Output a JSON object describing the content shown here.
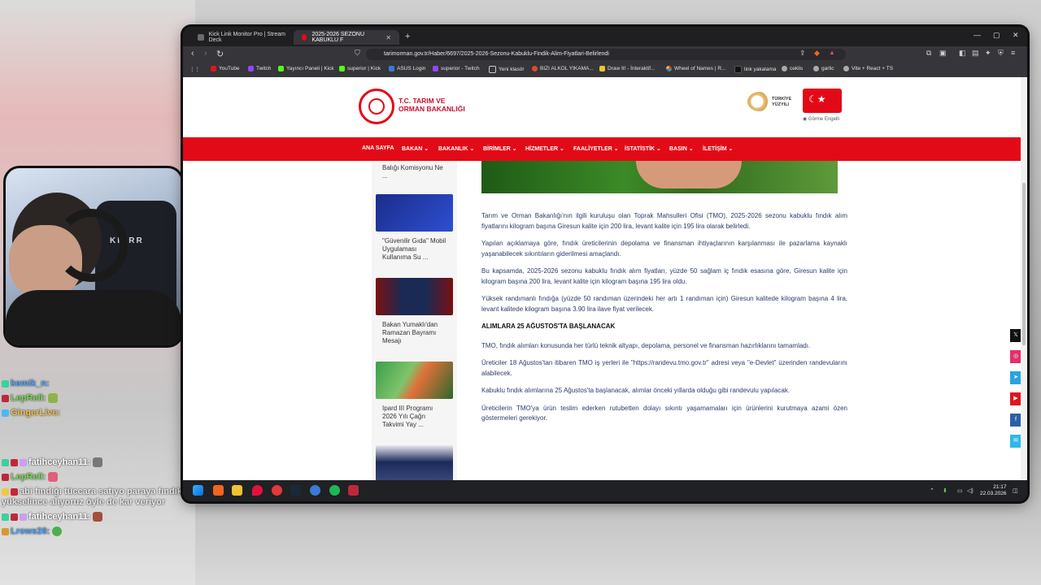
{
  "chat": [
    {
      "user": "kemik_n:",
      "message": "",
      "user_color": "#4fa3f7",
      "badge_color": "#3ad19a"
    },
    {
      "user": "LepRell:",
      "message": "",
      "user_color": "#7bd65a",
      "badge_color": "#c0283a"
    },
    {
      "user": "GingerLive:",
      "message": "",
      "user_color": "#f2c04a",
      "badge_color": "#4cb7ff"
    },
    {
      "user": "fatihceyhan11:",
      "message": "",
      "user_color": "#ffffff",
      "badge_color": "#3ad19a"
    },
    {
      "user": "LepRell:",
      "message": "",
      "user_color": "#7bd65a",
      "badge_color": "#c0283a"
    },
    {
      "user": "",
      "message": "abi fındığı tüccara satıyo paraya fındık yükselince alıyoruz öyle de kar veriyor",
      "user_color": "#9be36a",
      "badge_color": "#f4c542"
    },
    {
      "user": "fatihceyhan11:",
      "message": "",
      "user_color": "#ffffff",
      "badge_color": "#3ad19a"
    },
    {
      "user": "Lrows28:",
      "message": "",
      "user_color": "#4fa3f7",
      "badge_color": "#d79a2a"
    }
  ],
  "webcam": {
    "chair_label": "KIARR"
  },
  "browser": {
    "tabs": [
      {
        "label": "Kick Link Monitor Pro | Stream Deck",
        "active": false
      },
      {
        "label": "2025-2026 SEZONU KABUKLU F",
        "active": true
      }
    ],
    "url": "tarimorman.gov.tr/Haber/6697/2025-2026-Sezonu-Kabuklu-Findik-Alim-Fiyatlari-Belirlendi",
    "bookmarks": [
      "YouTube",
      "Twitch",
      "Yayıncı Paneli | Kick",
      "superior | Kick",
      "ASUS Login",
      "superior - Twitch",
      "Yeni klasör",
      "BIZI ALKOL YIKAMA...",
      "Draw It! - İnteraktif...",
      "Wheel of Names | R...",
      "link yakalama",
      "ceklis",
      "garlic",
      "Vite + React + TS"
    ]
  },
  "site": {
    "logo_line1": "T.C. TARIM VE",
    "logo_line2": "ORMAN BAKANLIĞI",
    "ty_line1": "TÜRKİYE",
    "ty_line2": "YÜZYILI",
    "accessibility": "Görme Engelli",
    "nav": [
      "ANA SAYFA",
      "BAKAN",
      "BAKANLIK",
      "BİRİMLER",
      "HİZMETLER",
      "FAALİYETLER",
      "İSTATİSTİK",
      "BASIN",
      "İLETİŞİM"
    ],
    "nav_chevron": "⌄"
  },
  "sidebar": [
    {
      "caption": "Balığı Komisyonu Ne ..."
    },
    {
      "caption": "\"Güvenilir Gıda\" Mobil Uygulaması Kullanıma Su ..."
    },
    {
      "caption": "Bakan Yumaklı'dan Ramazan Bayramı Mesajı"
    },
    {
      "caption": "Ipard III Programı 2026 Yılı Çağrı Takvimi Yay ..."
    },
    {
      "caption": ""
    }
  ],
  "article": {
    "p1": "Tarım ve Orman Bakanlığı'nın ilgili kuruluşu olan Toprak Mahsulleri Ofisi (TMO), 2025-2026 sezonu kabuklu fındık alım fiyatlarını kilogram başına Giresun kalite için 200 lira, levant kalite için 195 lira olarak belirledi.",
    "p2": "Yapılan açıklamaya göre, fındık üreticilerinin depolama ve finansman ihtiyaçlarının karşılanması ile pazarlama kaynaklı yaşanabilecek sıkıntıların giderilmesi amaçlandı.",
    "p3": "Bu kapsamda, 2025-2026 sezonu kabuklu fındık alım fiyatları, yüzde 50 sağlam iç fındık esasına göre, Giresun kalite için kilogram başına 200 lira, levant kalite için kilogram başına 195 lira oldu.",
    "p4": "Yüksek randımanlı fındığa (yüzde 50 randıman üzerindeki her artı 1 randıman için) Giresun kalitede kilogram başına 4 lira, levant kalitede kilogram başına 3.90 lira ilave fiyat verilecek.",
    "heading": "ALIMLARA 25 AĞUSTOS'TA BAŞLANACAK",
    "p5": "TMO, fındık alımları konusunda her türlü teknik altyapı, depolama, personel ve finansman hazırlıklarını tamamladı.",
    "p6": "Üreticiler 18 Ağustos'tan itibaren TMO iş yerleri ile \"https://randevu.tmo.gov.tr\" adresi veya \"e-Devlet\" üzerinden randevularını alabilecek.",
    "p7": "Kabuklu fındık alımlarına 25 Ağustos'ta başlanacak, alımlar önceki yıllarda olduğu gibi randevulu yapılacak.",
    "p8": "Üreticilerin TMO'ya ürün teslim ederken rutubetten dolayı sıkıntı yaşamamaları için ürünlerini kurutmaya azami özen göstermeleri gerekiyor."
  },
  "share": [
    {
      "icon": "x-icon",
      "glyph": "𝕏",
      "color": "#111111"
    },
    {
      "icon": "instagram-icon",
      "glyph": "◎",
      "color": "#e1306c"
    },
    {
      "icon": "telegram-icon",
      "glyph": "➤",
      "color": "#2aa3e0"
    },
    {
      "icon": "youtube-icon",
      "glyph": "▶",
      "color": "#e0141e"
    },
    {
      "icon": "facebook-icon",
      "glyph": "f",
      "color": "#2f5ea8"
    },
    {
      "icon": "email-icon",
      "glyph": "✉",
      "color": "#2fb8e8"
    }
  ],
  "taskbar": {
    "time": "21:17",
    "date": "22.03.2026"
  }
}
